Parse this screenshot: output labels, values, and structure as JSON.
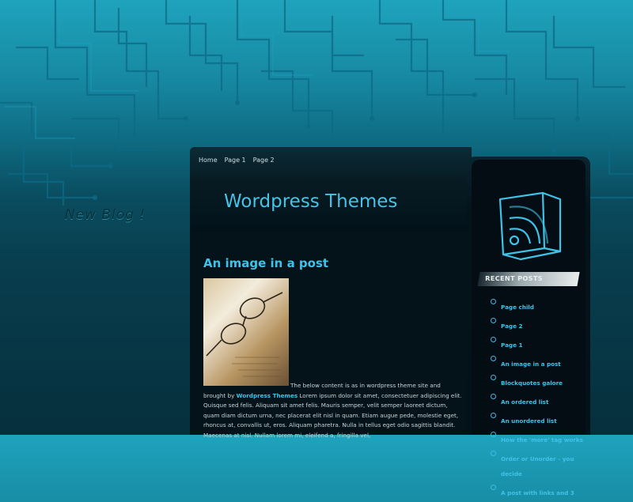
{
  "header": {
    "watermark": "New Blog !",
    "nav": [
      "Home",
      "Page 1",
      "Page 2"
    ],
    "site_title": "Wordpress Themes"
  },
  "post": {
    "title": "An image in a post",
    "text_line1": "The below content is as in wordpress theme site and",
    "brought_by": "brought by",
    "link": "Wordpress Themes",
    "text_rest": "Lorem ipsum dolor sit amet, consectetuer adipiscing elit. Quisque sed felis. Aliquam sit amet felis. Mauris semper, velit semper laoreet dictum, quam diam dictum urna, nec placerat elit nisl in quam. Etiam augue pede, molestie eget, rhoncus at, convallis ut, eros. Aliquam pharetra. Nulla in tellus eget odio sagittis blandit. Maecenas at nisl. Nullam lorem mi, eleifend a, fringilla vel,"
  },
  "sidebar": {
    "recent_posts_title": "RECENT POSTS",
    "recent_posts": [
      "Page child",
      "Page 2",
      "Page 1",
      "An image in a post",
      "Blockquotes galore",
      "An ordered list",
      "An unordered list",
      "How the 'more' tag works",
      "Order or Unorder - you decide",
      "A post with links and 3"
    ]
  },
  "colors": {
    "accent": "#3ec3e8",
    "panel": "#04131a"
  }
}
